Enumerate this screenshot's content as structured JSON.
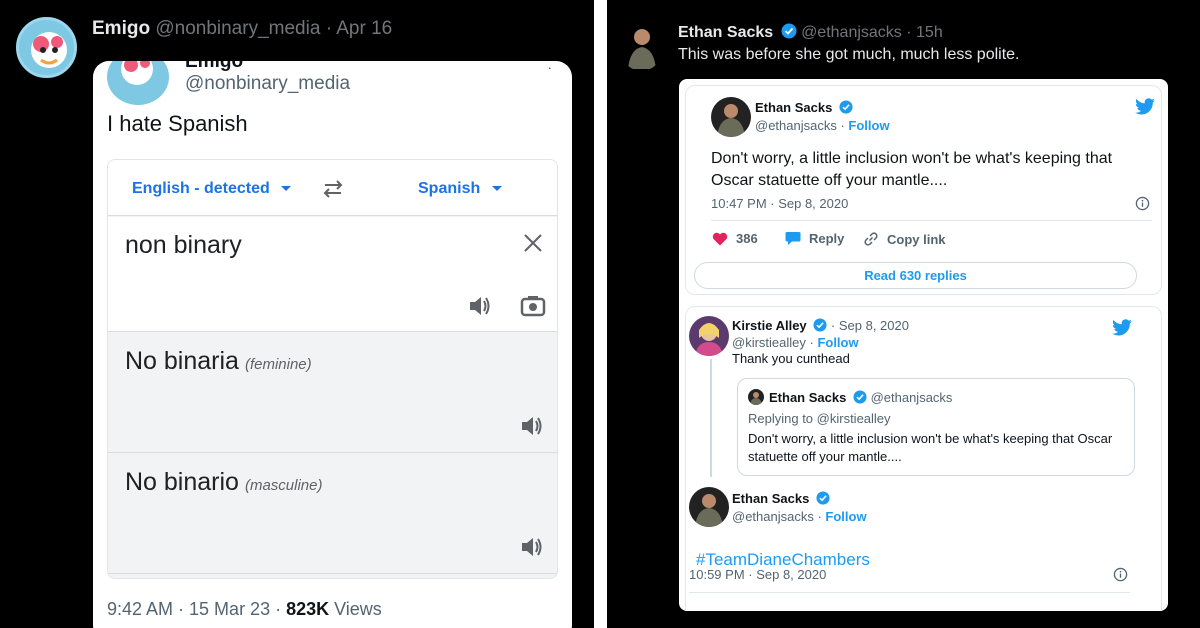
{
  "left": {
    "header": {
      "name": "Emigo",
      "handle": "@nonbinary_media",
      "date": "Apr 16"
    },
    "embedded": {
      "name": "Emigo",
      "handle": "@nonbinary_media",
      "text": "I hate Spanish",
      "translate": {
        "source_lang": "English - detected",
        "target_lang": "Spanish",
        "input": "non binary",
        "results": [
          {
            "text": "No binaria",
            "gender": "(feminine)"
          },
          {
            "text": "No binario",
            "gender": "(masculine)"
          }
        ]
      },
      "footer": {
        "time": "9:42 AM · 15 Mar 23 · ",
        "views_count": "823K",
        "views_label": " Views"
      }
    }
  },
  "right": {
    "header": {
      "name": "Ethan Sacks",
      "handle": "@ethanjsacks",
      "age": "15h"
    },
    "text": "This was before she got much, much less polite.",
    "tweet1": {
      "name": "Ethan Sacks",
      "handle": "@ethanjsacks · ",
      "follow": "Follow",
      "body": "Don't worry, a little inclusion won't be what's keeping that Oscar statuette off your mantle....",
      "time": "10:47 PM · Sep 8, 2020",
      "likes": "386",
      "reply": "Reply",
      "copy": "Copy link",
      "replies": "Read 630 replies"
    },
    "tweet2": {
      "name": "Kirstie Alley",
      "date": " · Sep 8, 2020",
      "handle": "@kirstiealley · ",
      "follow": "Follow",
      "body": "Thank you cunthead",
      "quote": {
        "name": "Ethan Sacks",
        "handle": "@ethanjsacks",
        "replying": "Replying to @kirstiealley",
        "body": "Don't worry, a little inclusion won't be what's keeping that Oscar statuette off your mantle...."
      },
      "reply_name": "Ethan Sacks",
      "reply_handle": "@ethanjsacks · ",
      "reply_follow": "Follow",
      "hashtag": "#TeamDianeChambers",
      "time": "10:59 PM · Sep 8, 2020"
    }
  },
  "colors": {
    "twitter_blue": "#1d9bf0",
    "google_blue": "#1a73e8",
    "heart": "#e0245e",
    "background": "#000000"
  }
}
